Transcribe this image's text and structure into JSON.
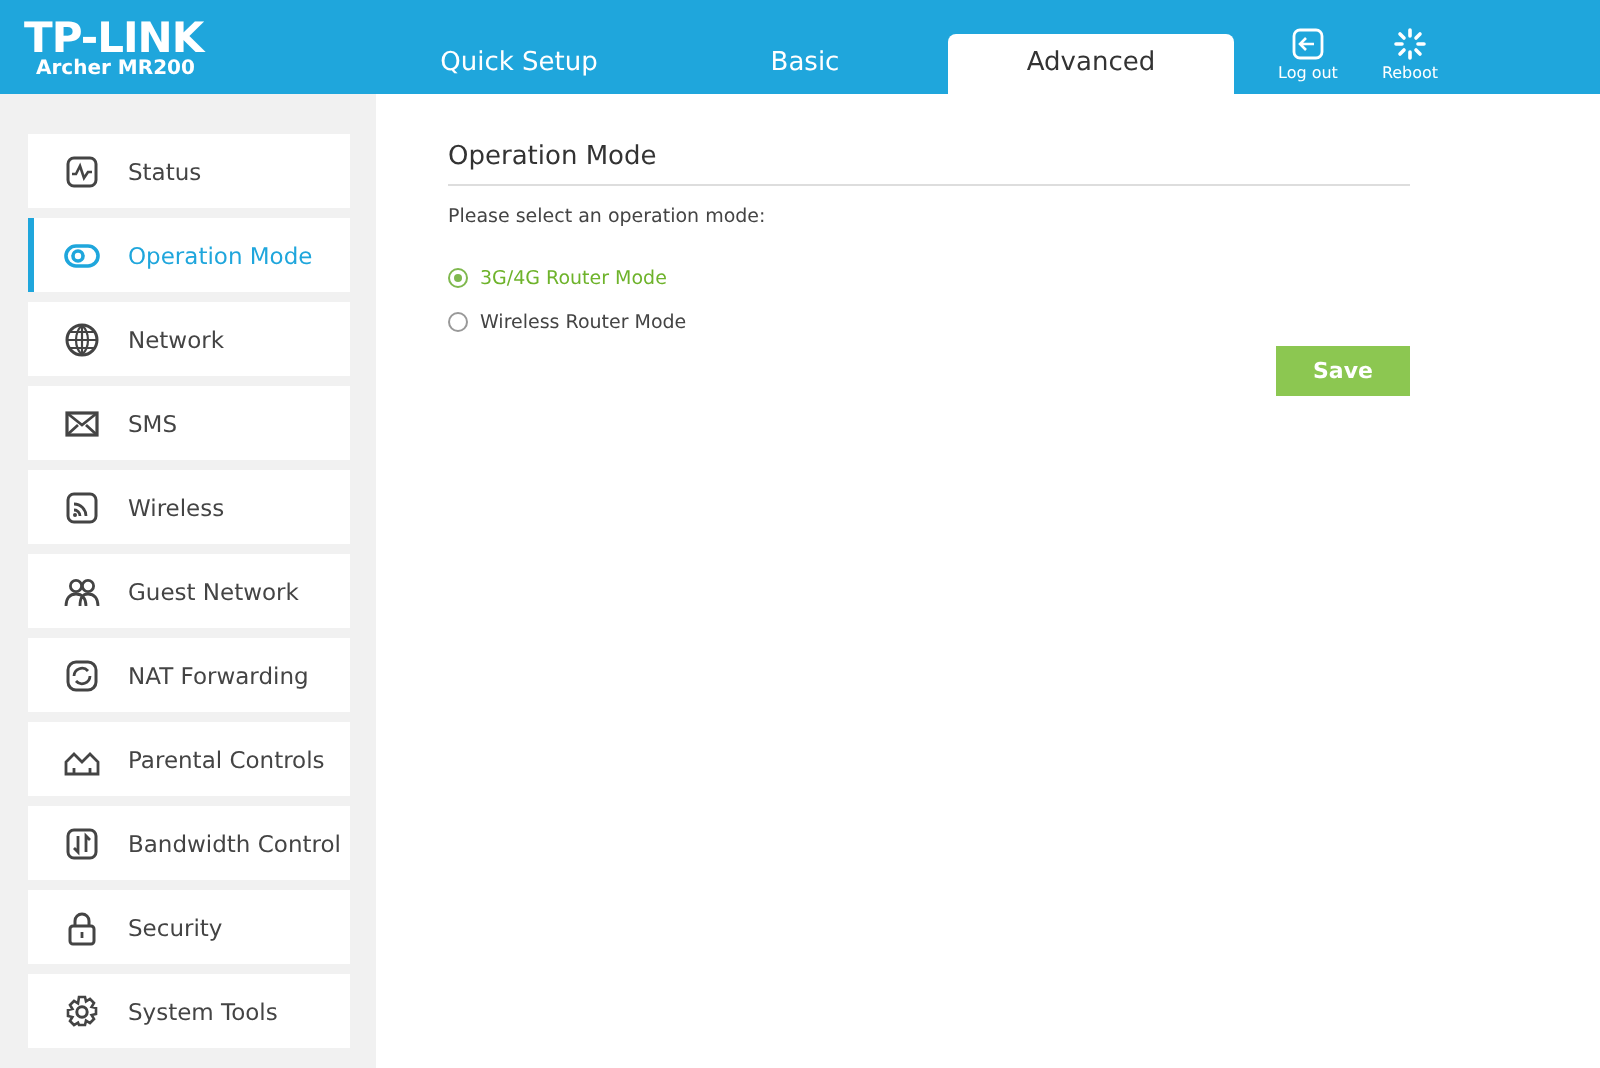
{
  "logo": {
    "brand": "TP-LINK",
    "model": "Archer MR200"
  },
  "tabs": [
    {
      "label": "Quick Setup",
      "selected": false
    },
    {
      "label": "Basic",
      "selected": false
    },
    {
      "label": "Advanced",
      "selected": true
    }
  ],
  "header_actions": [
    {
      "label": "Log out"
    },
    {
      "label": "Reboot"
    }
  ],
  "sidebar": {
    "items": [
      {
        "label": "Status",
        "selected": false
      },
      {
        "label": "Operation Mode",
        "selected": true
      },
      {
        "label": "Network",
        "selected": false
      },
      {
        "label": "SMS",
        "selected": false
      },
      {
        "label": "Wireless",
        "selected": false
      },
      {
        "label": "Guest Network",
        "selected": false
      },
      {
        "label": "NAT Forwarding",
        "selected": false
      },
      {
        "label": "Parental Controls",
        "selected": false
      },
      {
        "label": "Bandwidth Control",
        "selected": false
      },
      {
        "label": "Security",
        "selected": false
      },
      {
        "label": "System Tools",
        "selected": false
      }
    ]
  },
  "panel": {
    "title": "Operation Mode",
    "prompt": "Please select an operation mode:",
    "options": [
      {
        "label": "3G/4G Router Mode",
        "selected": true
      },
      {
        "label": "Wireless Router Mode",
        "selected": false
      }
    ],
    "button": "Save"
  }
}
